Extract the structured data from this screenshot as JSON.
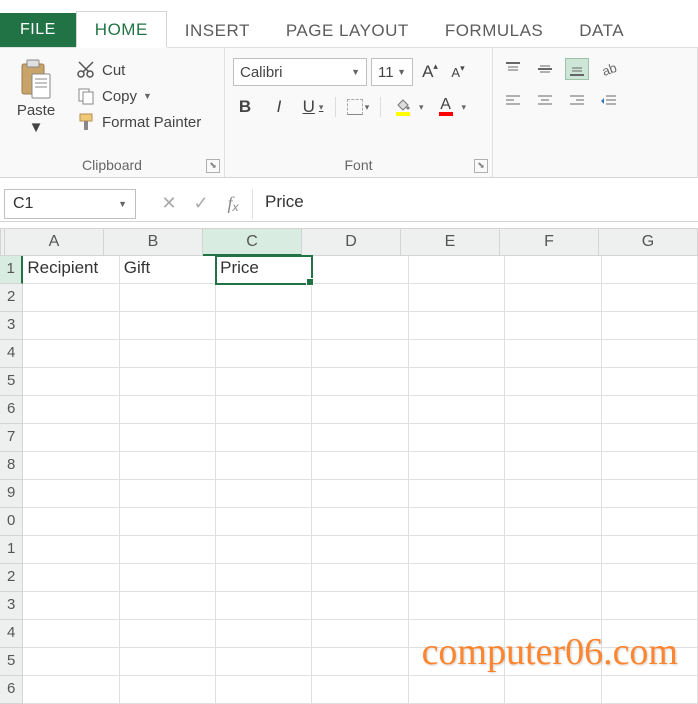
{
  "tabs": {
    "file": "FILE",
    "home": "HOME",
    "insert": "INSERT",
    "page_layout": "PAGE LAYOUT",
    "formulas": "FORMULAS",
    "data": "DATA"
  },
  "clipboard": {
    "paste": "Paste",
    "cut": "Cut",
    "copy": "Copy",
    "format_painter": "Format Painter",
    "group_label": "Clipboard"
  },
  "font": {
    "name": "Calibri",
    "size": "11",
    "bold": "B",
    "italic": "I",
    "underline": "U",
    "font_color_letter": "A",
    "increase_label": "A",
    "decrease_label": "A",
    "group_label": "Font"
  },
  "namebox": "C1",
  "formula_value": "Price",
  "columns": [
    "A",
    "B",
    "C",
    "D",
    "E",
    "F",
    "G"
  ],
  "row_numbers": [
    "1",
    "2",
    "3",
    "4",
    "5",
    "6",
    "7",
    "8",
    "9",
    "0",
    "1",
    "2",
    "3",
    "4",
    "5",
    "6"
  ],
  "cells": {
    "A1": "Recipient",
    "B1": "Gift",
    "C1": "Price"
  },
  "selected_cell": "C1",
  "watermark": "computer06.com"
}
